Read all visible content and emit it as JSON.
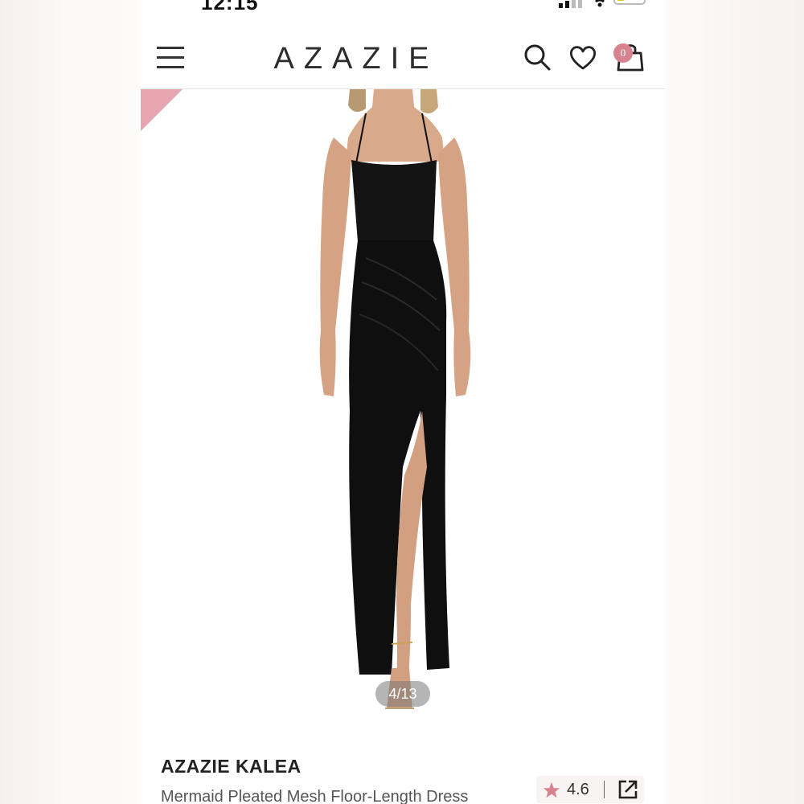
{
  "status_bar": {
    "time": "12:15"
  },
  "header": {
    "logo": "AZAZIE",
    "cart_count": "0",
    "icons": [
      "menu-icon",
      "search-icon",
      "heart-icon",
      "bag-icon"
    ]
  },
  "gallery": {
    "counter": "4/13",
    "accent_color": "#e7a5b0",
    "dress_color": "#111111"
  },
  "product": {
    "brand": "AZAZIE KALEA",
    "title": "Mermaid Pleated Mesh Floor-Length Dress",
    "rating": "4.6"
  },
  "colors": {
    "brand_pink": "#d9828f",
    "star": "#d9828f",
    "text": "#222222"
  }
}
